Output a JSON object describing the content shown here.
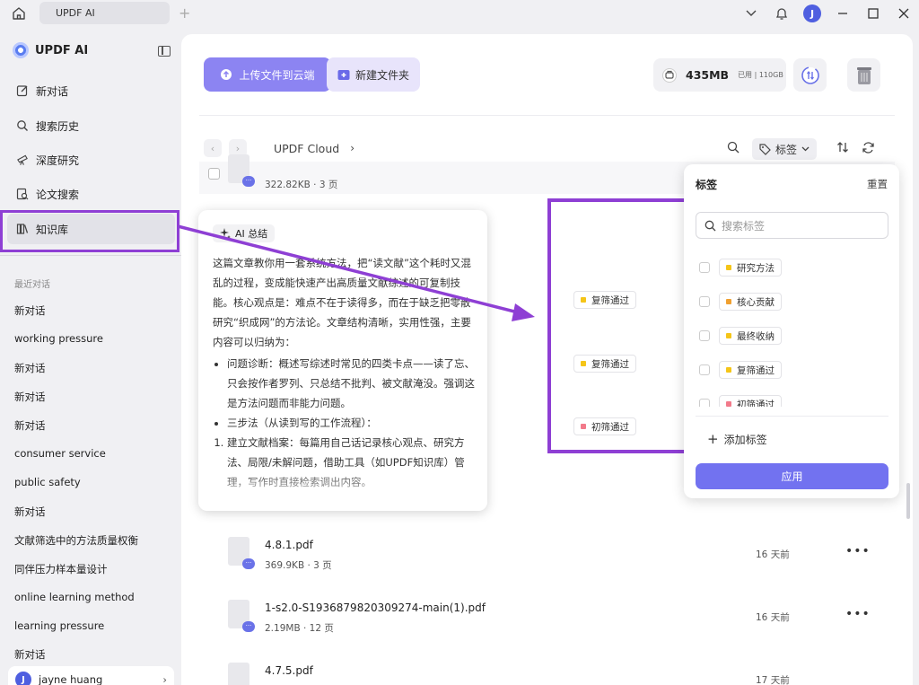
{
  "titlebar": {
    "tab_title": "UPDF AI",
    "avatar_letter": "J"
  },
  "sidebar": {
    "brand": "UPDF AI",
    "nav": [
      {
        "label": "新对话",
        "icon": "edit-icon"
      },
      {
        "label": "搜索历史",
        "icon": "search-icon"
      },
      {
        "label": "深度研究",
        "icon": "telescope-icon"
      },
      {
        "label": "论文搜索",
        "icon": "paper-search-icon"
      },
      {
        "label": "知识库",
        "icon": "library-icon"
      }
    ],
    "recent_title": "最近对话",
    "recent": [
      "新对话",
      "working pressure",
      "新对话",
      "新对话",
      "新对话",
      "consumer service",
      "public safety",
      "新对话",
      "文献筛选中的方法质量权衡",
      "同伴压力样本量设计",
      "online learning method",
      "learning pressure",
      "新对话"
    ],
    "user": {
      "name": "jayne huang",
      "initial": "J"
    }
  },
  "toolbar": {
    "upload_label": "上传文件到云端",
    "new_folder_label": "新建文件夹",
    "storage_used": "435MB",
    "storage_used_label": "已用",
    "storage_total": "110GB"
  },
  "path": {
    "crumb": "UPDF Cloud",
    "tag_button": "标签"
  },
  "files": [
    {
      "name": "",
      "meta": "322.82KB · 3 页",
      "time": ""
    },
    {
      "name": "4.8.1.pdf",
      "meta": "369.9KB · 3 页",
      "time": "16 天前"
    },
    {
      "name": "1-s2.0-S1936879820309274-main(1).pdf",
      "meta": "2.19MB · 12 页",
      "time": "16 天前"
    },
    {
      "name": "4.7.5.pdf",
      "meta": "",
      "time": "17 天前"
    }
  ],
  "ai_summary": {
    "badge": "AI 总结",
    "intro": "这篇文章教你用一套系统方法，把“读文献”这个耗时又混乱的过程，变成能快速产出高质量文献综述的可复制技能。核心观点是：难点不在于读得多，而在于缺乏把零散研究“织成网”的方法论。文章结构清晰，实用性强，主要内容可以归纳为：",
    "bullet1": "问题诊断：概述写综述时常见的四类卡点——读了忘、只会按作者罗列、只总结不批判、被文献淹没。强调这是方法问题而非能力问题。",
    "bullet2": "三步法（从读到写的工作流程）：",
    "step1": "建立文献档案：每篇用自己话记录核心观点、研究方法、局限/未解问题，借助工具（如UPDF知识库）管理，写作时直接检索调出内容。"
  },
  "row_tags": [
    {
      "label": "复筛通过",
      "color": "#f5c518"
    },
    {
      "label": "复筛通过",
      "color": "#f5c518"
    },
    {
      "label": "初筛通过",
      "color": "#f27a8a"
    }
  ],
  "tag_panel": {
    "title": "标签",
    "reset": "重置",
    "search_placeholder": "搜索标签",
    "items": [
      {
        "label": "研究方法",
        "color": "#f5c518"
      },
      {
        "label": "核心贡献",
        "color": "#f0a030"
      },
      {
        "label": "最终收纳",
        "color": "#f5c518"
      },
      {
        "label": "复筛通过",
        "color": "#f5c518"
      },
      {
        "label": "初筛通过",
        "color": "#f27a8a"
      }
    ],
    "add_label": "添加标签",
    "apply_label": "应用"
  },
  "colors": {
    "accent": "#8c84f2",
    "annotation": "#8e3fd4",
    "apply": "#7272f0"
  }
}
